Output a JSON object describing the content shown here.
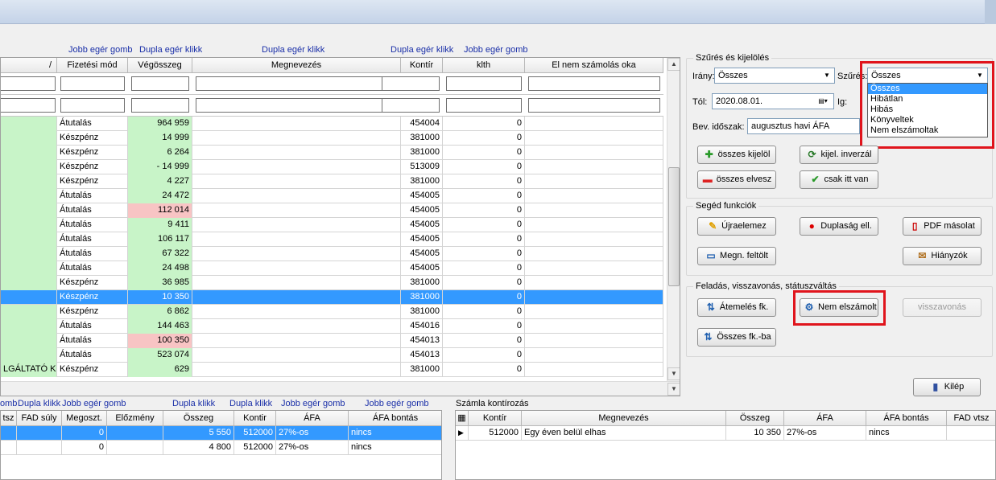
{
  "colors": {
    "green_cell": "#c8f4c8",
    "pink_cell": "#f8c4c4",
    "selection": "#3399ff",
    "highlight_red": "#e0141c",
    "hint_blue": "#1a2fa8"
  },
  "top_hints": [
    "Jobb egér gomb",
    "Dupla egér klikk",
    "Dupla egér klikk",
    "Dupla egér klikk",
    "Jobb egér gomb"
  ],
  "grid": {
    "columns": [
      "/",
      "Fizetési mód",
      "Végösszeg",
      "Megnevezés",
      "Kontír",
      "klth",
      "El nem számolás oka"
    ],
    "rows": [
      {
        "left": "",
        "mode": "Átutalás",
        "total": "964 959",
        "name": "",
        "kontir": "454004",
        "klth": "0",
        "hl": "green"
      },
      {
        "left": "",
        "mode": "Készpénz",
        "total": "14 999",
        "name": "",
        "kontir": "381000",
        "klth": "0",
        "hl": "green"
      },
      {
        "left": "",
        "mode": "Készpénz",
        "total": "6 264",
        "name": "",
        "kontir": "381000",
        "klth": "0",
        "hl": "green"
      },
      {
        "left": "",
        "mode": "Készpénz",
        "total": "- 14 999",
        "name": "",
        "kontir": "513009",
        "klth": "0",
        "hl": "green"
      },
      {
        "left": "",
        "mode": "Készpénz",
        "total": "4 227",
        "name": "",
        "kontir": "381000",
        "klth": "0",
        "hl": "green"
      },
      {
        "left": "",
        "mode": "Átutalás",
        "total": "24 472",
        "name": "",
        "kontir": "454005",
        "klth": "0",
        "hl": "green"
      },
      {
        "left": "",
        "mode": "Átutalás",
        "total": "112 014",
        "name": "",
        "kontir": "454005",
        "klth": "0",
        "hl": "pink"
      },
      {
        "left": "",
        "mode": "Átutalás",
        "total": "9 411",
        "name": "",
        "kontir": "454005",
        "klth": "0",
        "hl": "green"
      },
      {
        "left": "",
        "mode": "Átutalás",
        "total": "106 117",
        "name": "",
        "kontir": "454005",
        "klth": "0",
        "hl": "green"
      },
      {
        "left": "",
        "mode": "Átutalás",
        "total": "67 322",
        "name": "",
        "kontir": "454005",
        "klth": "0",
        "hl": "green"
      },
      {
        "left": "",
        "mode": "Átutalás",
        "total": "24 498",
        "name": "",
        "kontir": "454005",
        "klth": "0",
        "hl": "green"
      },
      {
        "left": "",
        "mode": "Készpénz",
        "total": "36 985",
        "name": "",
        "kontir": "381000",
        "klth": "0",
        "hl": "green"
      },
      {
        "left": "",
        "mode": "Készpénz",
        "total": "10 350",
        "name": "",
        "kontir": "381000",
        "klth": "0",
        "hl": "sel"
      },
      {
        "left": "",
        "mode": "Készpénz",
        "total": "6 862",
        "name": "",
        "kontir": "381000",
        "klth": "0",
        "hl": "green"
      },
      {
        "left": "",
        "mode": "Átutalás",
        "total": "144 463",
        "name": "",
        "kontir": "454016",
        "klth": "0",
        "hl": "green"
      },
      {
        "left": "",
        "mode": "Átutalás",
        "total": "100 350",
        "name": "",
        "kontir": "454013",
        "klth": "0",
        "hl": "pink"
      },
      {
        "left": "",
        "mode": "Átutalás",
        "total": "523 074",
        "name": "",
        "kontir": "454013",
        "klth": "0",
        "hl": "green"
      },
      {
        "left": "LGÁLTATÓ KF",
        "mode": "Készpénz",
        "total": "629",
        "name": "",
        "kontir": "381000",
        "klth": "0",
        "hl": "green"
      }
    ]
  },
  "filter_panel": {
    "title": "Szűrés és kijelölés",
    "irany_label": "Irány:",
    "irany_value": "Összes",
    "szures_label": "Szűrés:",
    "szures_value": "Összes",
    "dropdown_options": [
      "Összes",
      "Hibátlan",
      "Hibás",
      "Könyveltek",
      "Nem elszámoltak"
    ],
    "tol_label": "Tól:",
    "tol_value": "2020.08.01.",
    "ig_label": "Ig:",
    "bev_label": "Bev. időszak:",
    "bev_value": "augusztus havi ÁFA",
    "btn_select_all": "összes kijelöl",
    "btn_invert": "kijel. inverzál",
    "btn_deselect": "összes elvesz",
    "btn_only_here": "csak itt van"
  },
  "helper_panel": {
    "title": "Segéd funkciók",
    "btn_reanalyze": "Újraelemez",
    "btn_duplicate": "Duplaság ell.",
    "btn_pdf": "PDF másolat",
    "btn_fill_name": "Megn. feltölt",
    "btn_missing": "Hiányzók"
  },
  "status_panel": {
    "title": "Feladás, visszavonás, státuszváltás",
    "btn_transfer": "Átemelés fk.",
    "btn_not_settled": "Nem elszámolt",
    "btn_revoke": "visszavonás",
    "btn_all_to": "Összes fk.-ba"
  },
  "exit_label": "Kilép",
  "bottom_hints": [
    "omb",
    "Dupla klikk",
    "Jobb egér gomb",
    "Dupla klikk",
    "Dupla klikk",
    "Jobb egér gomb",
    "Jobb egér gomb"
  ],
  "bottom_left": {
    "columns": [
      "tsz",
      "FAD súly",
      "Megoszt.",
      "Előzmény",
      "Összeg",
      "Kontir",
      "ÁFA",
      "ÁFA bontás"
    ],
    "rows": [
      {
        "megoszt": "0",
        "elozmeny": "",
        "osszeg": "5 550",
        "kontir": "512000",
        "afa": "27%-os",
        "bontas": "nincs",
        "sel": true
      },
      {
        "megoszt": "0",
        "elozmeny": "",
        "osszeg": "4 800",
        "kontir": "512000",
        "afa": "27%-os",
        "bontas": "nincs",
        "sel": false
      }
    ]
  },
  "bottom_right": {
    "title": "Számla kontírozás",
    "columns": [
      "Kontír",
      "Megnevezés",
      "Összeg",
      "ÁFA",
      "ÁFA bontás",
      "FAD vtsz"
    ],
    "rows": [
      {
        "kontir": "512000",
        "name": "Egy éven belül elhas",
        "osszeg": "10 350",
        "afa": "27%-os",
        "bontas": "nincs",
        "fad": ""
      }
    ]
  }
}
